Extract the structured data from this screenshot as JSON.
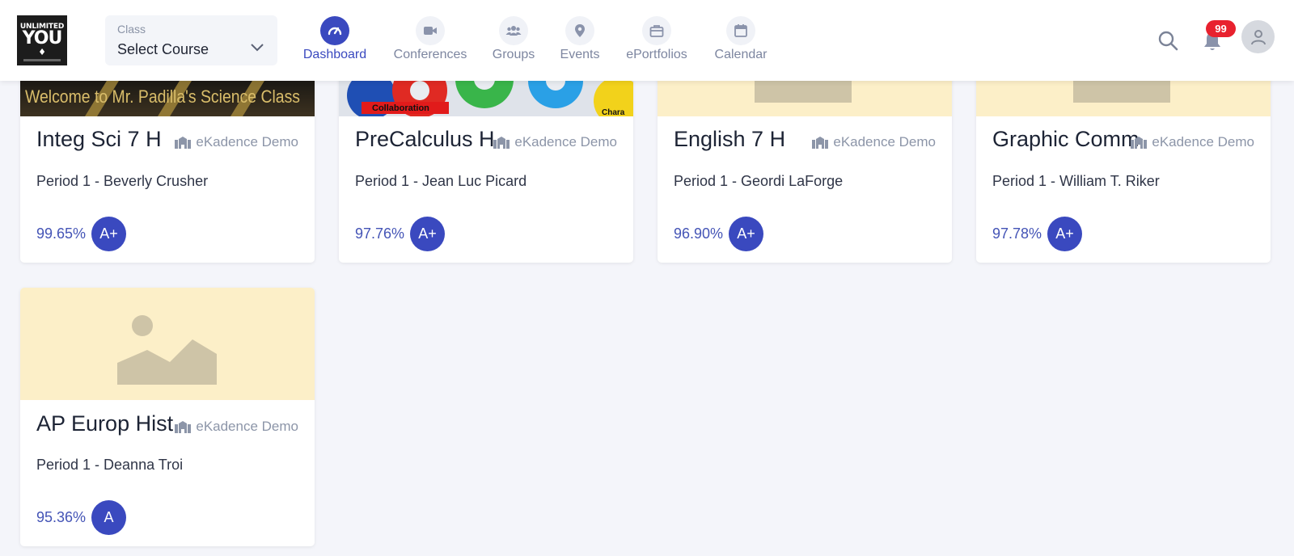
{
  "header": {
    "logo": {
      "line1": "UNLIMITED",
      "line2": "YOU"
    },
    "class_select": {
      "label": "Class",
      "value": "Select Course"
    },
    "nav": [
      {
        "label": "Dashboard",
        "icon": "dashboard-gauge-icon"
      },
      {
        "label": "Conferences",
        "icon": "video-camera-icon"
      },
      {
        "label": "Groups",
        "icon": "users-group-icon"
      },
      {
        "label": "Events",
        "icon": "map-pin-icon"
      },
      {
        "label": "ePortfolios",
        "icon": "briefcase-icon"
      },
      {
        "label": "Calendar",
        "icon": "calendar-icon"
      }
    ],
    "notifications_count": "99"
  },
  "banner_texts": {
    "science": "Welcome to Mr. Padilla's Science Class",
    "collab": "Collaboration",
    "chara": "Chara"
  },
  "courses": [
    {
      "title": "Integ Sci 7 H",
      "org": "eKadence Demo",
      "period": "Period 1 - Beverly Crusher",
      "percent": "99.65%",
      "grade": "A+"
    },
    {
      "title": "PreCalculus H",
      "org": "eKadence Demo",
      "period": "Period 1 - Jean Luc Picard",
      "percent": "97.76%",
      "grade": "A+"
    },
    {
      "title": "English 7 H",
      "org": "eKadence Demo",
      "period": "Period 1 - Geordi LaForge",
      "percent": "96.90%",
      "grade": "A+"
    },
    {
      "title": "Graphic Comm",
      "org": "eKadence Demo",
      "period": "Period 1 - William T. Riker",
      "percent": "97.78%",
      "grade": "A+"
    },
    {
      "title": "AP Europ Hist",
      "org": "eKadence Demo",
      "period": "Period 1 - Deanna Troi",
      "percent": "95.36%",
      "grade": "A"
    }
  ],
  "colors": {
    "accent": "#3a49bf",
    "badge": "#e8212e",
    "placeholder_bg": "#fcefc8",
    "page_bg": "#f4f5fa"
  }
}
